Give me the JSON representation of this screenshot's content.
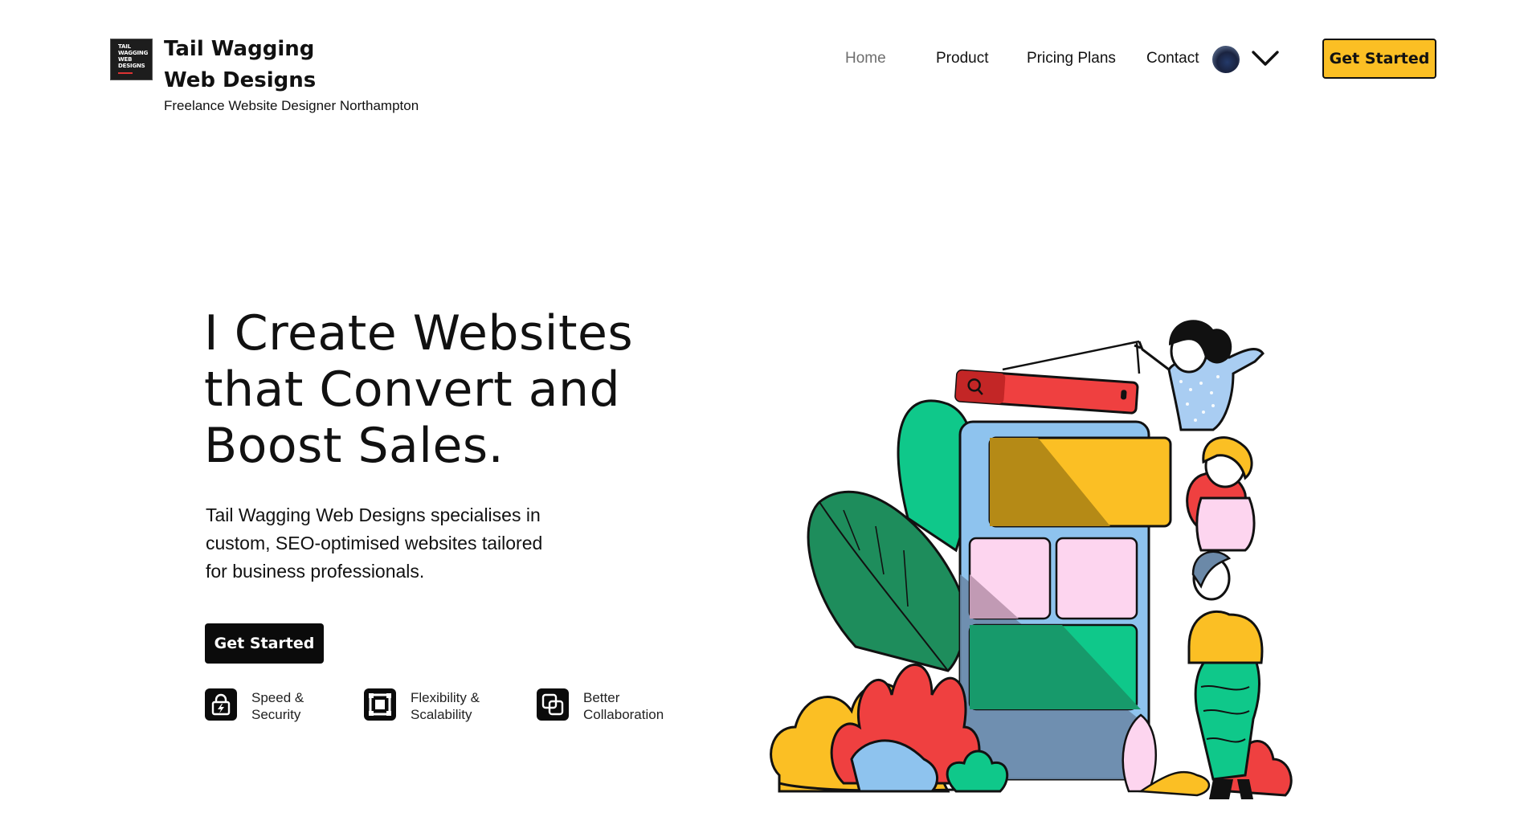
{
  "header": {
    "logo_lines": [
      "TAIL",
      "WAGGING",
      "WEB",
      "DESIGNS"
    ],
    "brand_line1": "Tail Wagging",
    "brand_line2": "Web Designs",
    "tagline": "Freelance Website Designer Northampton",
    "nav": [
      {
        "label": "Home",
        "active": true
      },
      {
        "label": "Product",
        "active": false
      },
      {
        "label": "Pricing Plans",
        "active": false
      },
      {
        "label": "Contact",
        "active": false
      }
    ],
    "account_icon": "user-avatar",
    "dropdown_icon": "chevron-down-icon",
    "cta_label": "Get Started"
  },
  "hero": {
    "title_line1": "I Create Websites",
    "title_line2": "that Convert and",
    "title_line3": "Boost Sales.",
    "description_line1": "Tail Wagging Web Designs specialises in",
    "description_line2": "custom, SEO-optimised websites tailored",
    "description_line3": "for business professionals.",
    "cta_label": "Get Started",
    "features": [
      {
        "icon": "lock-lightning-icon",
        "line1": "Speed &",
        "line2": "Security"
      },
      {
        "icon": "frame-icon",
        "line1": "Flexibility &",
        "line2": "Scalability"
      },
      {
        "icon": "overlap-squares-icon",
        "line1": "Better",
        "line2": "Collaboration"
      }
    ]
  },
  "colors": {
    "accent": "#fbbf24",
    "dark": "#0b0b0b",
    "nav_active": "#6e6e6e",
    "illustration_green": "#0fc88a",
    "illustration_red": "#ef4040",
    "illustration_blue": "#8ec3ee",
    "illustration_pink": "#fdd5ef"
  }
}
